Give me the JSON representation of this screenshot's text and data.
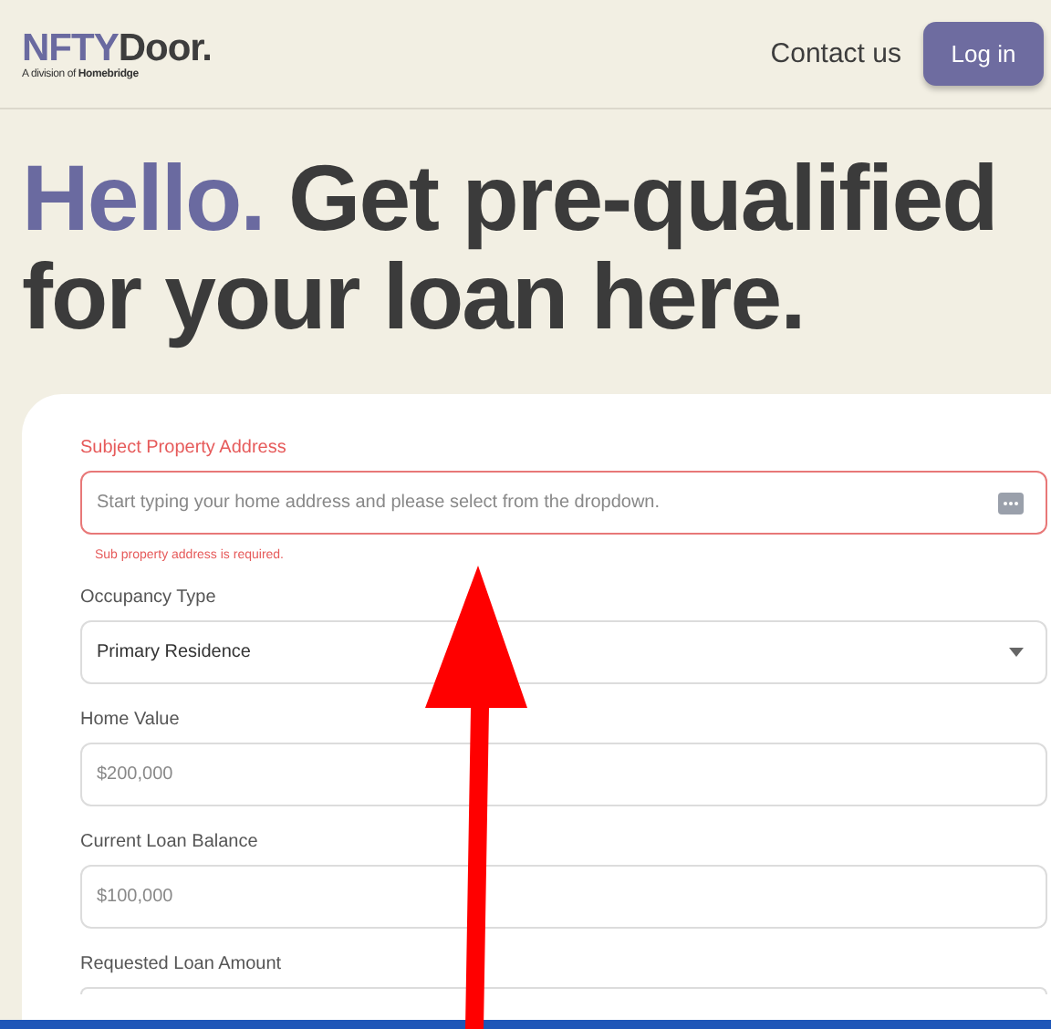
{
  "header": {
    "logo_primary": "NFTY",
    "logo_secondary": "Door.",
    "tagline_prefix": "A division of",
    "tagline_brand": "Homebridge",
    "nav_link": "Contact us",
    "login_button": "Log in"
  },
  "headline": {
    "accent": "Hello.",
    "text": "Get pre-qualified for your loan here."
  },
  "form": {
    "fields": [
      {
        "kind": "address",
        "label": "Subject Property Address",
        "placeholder": "Start typing your home address and please select from the dropdown.",
        "invalid": true,
        "error": "Sub property address is required."
      },
      {
        "kind": "select",
        "label": "Occupancy Type",
        "value": "Primary Residence",
        "invalid": false
      },
      {
        "kind": "text",
        "label": "Home Value",
        "placeholder": "$200,000",
        "invalid": false
      },
      {
        "kind": "text",
        "label": "Current Loan Balance",
        "placeholder": "$100,000",
        "invalid": false
      },
      {
        "kind": "text",
        "label": "Requested Loan Amount",
        "invalid": false
      }
    ]
  },
  "annotation": {
    "kind": "arrow"
  }
}
